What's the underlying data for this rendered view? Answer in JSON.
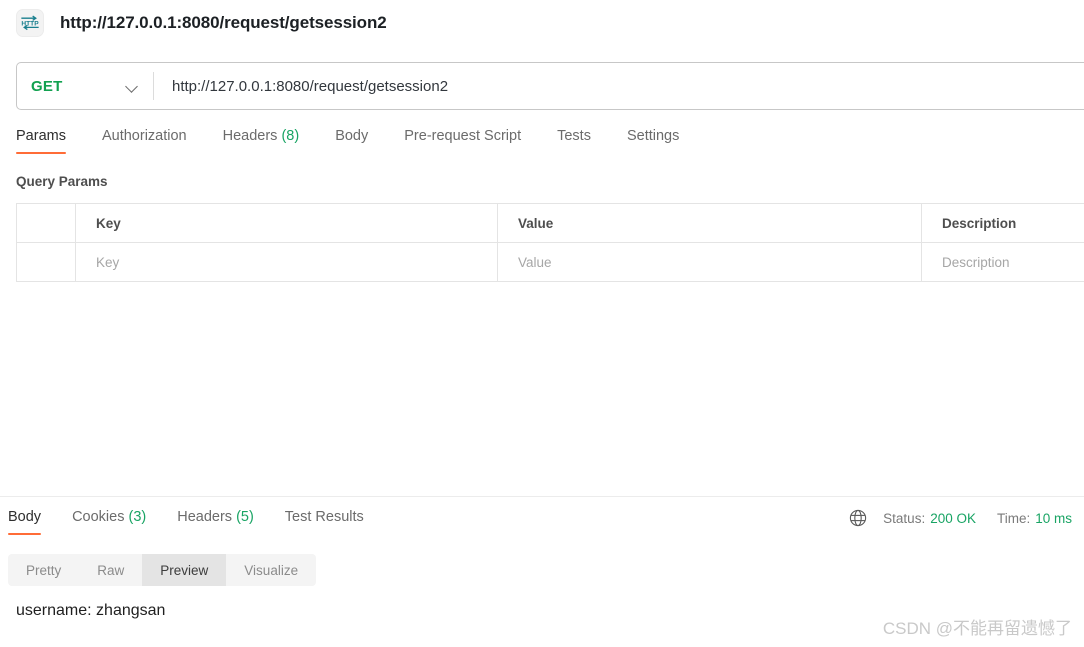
{
  "window": {
    "title": "http://127.0.0.1:8080/request/getsession2",
    "icon": "http-protocol-icon"
  },
  "request": {
    "method": "GET",
    "method_color": "#12a150",
    "url": "http://127.0.0.1:8080/request/getsession2",
    "url_placeholder": "Enter request URL",
    "dropdown_icon": "chevron-down-icon",
    "tabs": [
      {
        "label": "Params",
        "count": "",
        "active": true
      },
      {
        "label": "Authorization",
        "count": "",
        "active": false
      },
      {
        "label": "Headers",
        "count": "(8)",
        "active": false
      },
      {
        "label": "Body",
        "count": "",
        "active": false
      },
      {
        "label": "Pre-request Script",
        "count": "",
        "active": false
      },
      {
        "label": "Tests",
        "count": "",
        "active": false
      },
      {
        "label": "Settings",
        "count": "",
        "active": false
      }
    ]
  },
  "query_params": {
    "section_title": "Query Params",
    "columns": [
      "",
      "Key",
      "Value",
      "Description"
    ],
    "rows": [
      {
        "key": "Key",
        "value": "Value",
        "description": "Description"
      }
    ]
  },
  "response": {
    "tabs": [
      {
        "label": "Body",
        "count": "",
        "active": true
      },
      {
        "label": "Cookies",
        "count": "(3)",
        "active": false
      },
      {
        "label": "Headers",
        "count": "(5)",
        "active": false
      },
      {
        "label": "Test Results",
        "count": "",
        "active": false
      }
    ],
    "status": {
      "globe_icon": "globe-icon",
      "status_label": "Status:",
      "status_value": "200 OK",
      "time_label": "Time:",
      "time_value": "10 ms"
    },
    "formats": [
      {
        "label": "Pretty",
        "active": false
      },
      {
        "label": "Raw",
        "active": false
      },
      {
        "label": "Preview",
        "active": true
      },
      {
        "label": "Visualize",
        "active": false
      }
    ],
    "body_text": "username: zhangsan"
  },
  "watermark": "CSDN @不能再留遗憾了",
  "colors": {
    "accent_orange": "#ff6c37",
    "success_green": "#19a464",
    "method_green": "#12a150",
    "border": "#e4e4e4",
    "muted_text": "#6b6b6b"
  }
}
